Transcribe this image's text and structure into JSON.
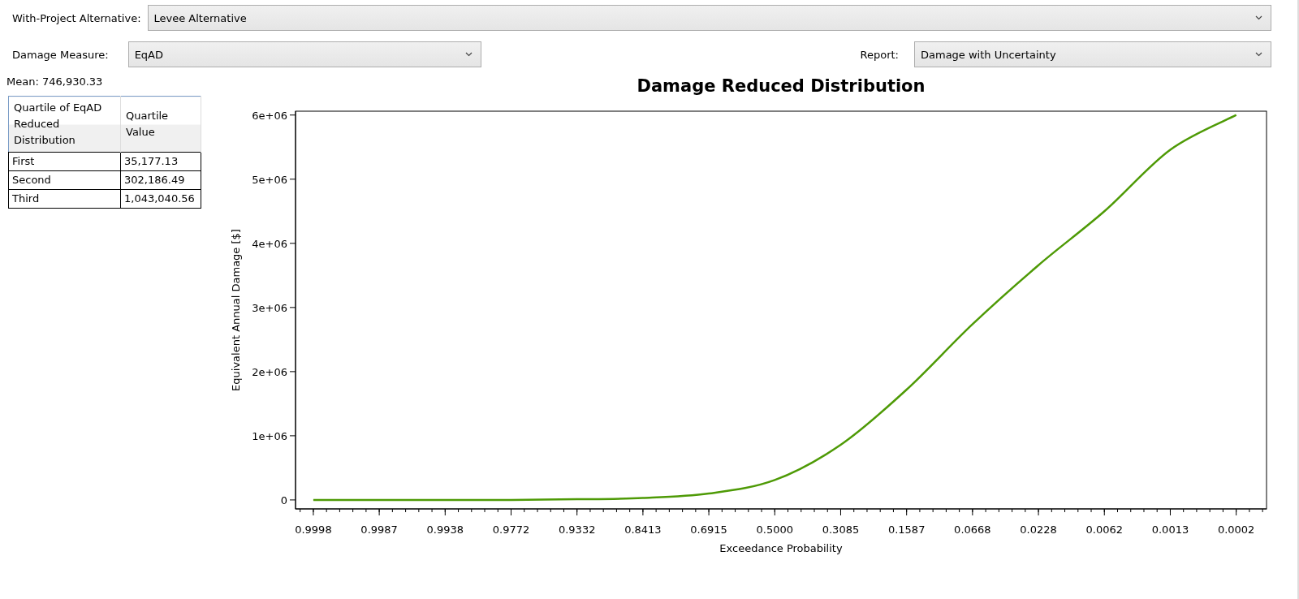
{
  "alternative": {
    "label": "With-Project Alternative:",
    "value": "Levee Alternative"
  },
  "damage_measure": {
    "label": "Damage Measure:",
    "value": "EqAD"
  },
  "report": {
    "label": "Report:",
    "value": "Damage with Uncertainty"
  },
  "mean": {
    "label": "Mean:",
    "value": "746,930.33"
  },
  "table": {
    "columns": [
      "Quartile of EqAD Reduced Distribution",
      "Quartile Value"
    ],
    "rows": [
      [
        "First",
        "35,177.13"
      ],
      [
        "Second",
        "302,186.49"
      ],
      [
        "Third",
        "1,043,040.56"
      ]
    ]
  },
  "chart": {
    "chart_data": {
      "type": "line",
      "title": "Damage Reduced Distribution",
      "xlabel": "Exceedance Probability",
      "ylabel": "Equivalent Annual Damage [$]",
      "categories": [
        "0.9998",
        "0.9987",
        "0.9938",
        "0.9772",
        "0.9332",
        "0.8413",
        "0.6915",
        "0.5000",
        "0.3085",
        "0.1587",
        "0.0668",
        "0.0228",
        "0.0062",
        "0.0013",
        "0.0002"
      ],
      "series": [
        {
          "color": "#4e9a06",
          "values": [
            0,
            0,
            0,
            0,
            10000,
            30000,
            100000,
            310000,
            860000,
            1720000,
            2740000,
            3660000,
            4500000,
            5460000,
            6000000
          ]
        }
      ],
      "ylim": [
        -140000,
        6060000
      ],
      "yticks": [
        {
          "value": 0,
          "label": "0"
        },
        {
          "value": 1000000,
          "label": "1e+06"
        },
        {
          "value": 2000000,
          "label": "2e+06"
        },
        {
          "value": 3000000,
          "label": "3e+06"
        },
        {
          "value": 4000000,
          "label": "4e+06"
        },
        {
          "value": 5000000,
          "label": "5e+06"
        },
        {
          "value": 6000000,
          "label": "6e+06"
        }
      ]
    }
  }
}
